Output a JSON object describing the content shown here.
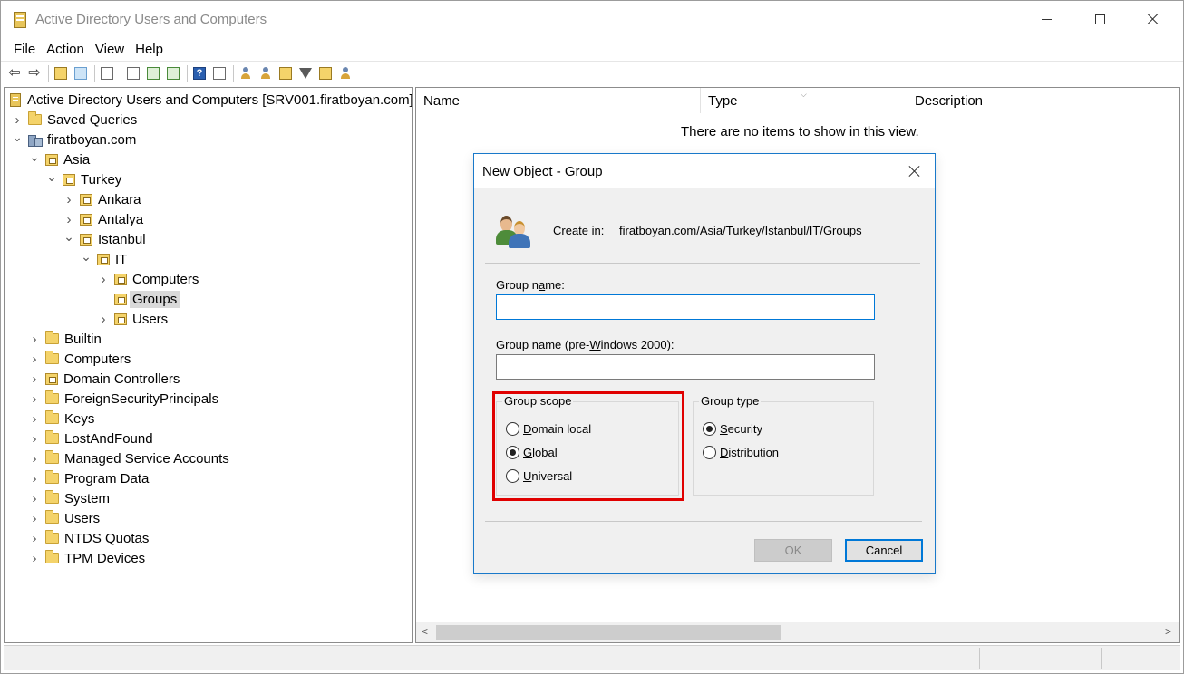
{
  "window": {
    "title": "Active Directory Users and Computers"
  },
  "menu": [
    "File",
    "Action",
    "View",
    "Help"
  ],
  "tree": {
    "root": "Active Directory Users and Computers [SRV001.firatboyan.com]",
    "items": [
      {
        "label": "Saved Queries",
        "level": 1,
        "chevron": "right",
        "icon": "folder-icon"
      },
      {
        "label": "firatboyan.com",
        "level": 1,
        "chevron": "down",
        "icon": "domain-icon"
      },
      {
        "label": "Asia",
        "level": 2,
        "chevron": "down",
        "icon": "ou-icon"
      },
      {
        "label": "Turkey",
        "level": 3,
        "chevron": "down",
        "icon": "ou-icon"
      },
      {
        "label": "Ankara",
        "level": 4,
        "chevron": "right",
        "icon": "ou-icon"
      },
      {
        "label": "Antalya",
        "level": 4,
        "chevron": "right",
        "icon": "ou-icon"
      },
      {
        "label": "Istanbul",
        "level": 4,
        "chevron": "down",
        "icon": "ou-icon"
      },
      {
        "label": "IT",
        "level": 5,
        "chevron": "down",
        "icon": "ou-icon"
      },
      {
        "label": "Computers",
        "level": 6,
        "chevron": "right",
        "icon": "ou-icon"
      },
      {
        "label": "Groups",
        "level": 6,
        "chevron": "none",
        "icon": "ou-icon",
        "selected": true
      },
      {
        "label": "Users",
        "level": 6,
        "chevron": "right",
        "icon": "ou-icon"
      },
      {
        "label": "Builtin",
        "level": 2,
        "chevron": "right",
        "icon": "folder-icon"
      },
      {
        "label": "Computers",
        "level": 2,
        "chevron": "right",
        "icon": "folder-icon"
      },
      {
        "label": "Domain Controllers",
        "level": 2,
        "chevron": "right",
        "icon": "ou-icon"
      },
      {
        "label": "ForeignSecurityPrincipals",
        "level": 2,
        "chevron": "right",
        "icon": "folder-icon"
      },
      {
        "label": "Keys",
        "level": 2,
        "chevron": "right",
        "icon": "folder-icon"
      },
      {
        "label": "LostAndFound",
        "level": 2,
        "chevron": "right",
        "icon": "folder-icon"
      },
      {
        "label": "Managed Service Accounts",
        "level": 2,
        "chevron": "right",
        "icon": "folder-icon"
      },
      {
        "label": "Program Data",
        "level": 2,
        "chevron": "right",
        "icon": "folder-icon"
      },
      {
        "label": "System",
        "level": 2,
        "chevron": "right",
        "icon": "folder-icon"
      },
      {
        "label": "Users",
        "level": 2,
        "chevron": "right",
        "icon": "folder-icon"
      },
      {
        "label": "NTDS Quotas",
        "level": 2,
        "chevron": "right",
        "icon": "folder-icon"
      },
      {
        "label": "TPM Devices",
        "level": 2,
        "chevron": "right",
        "icon": "folder-icon"
      }
    ]
  },
  "list": {
    "columns": [
      "Name",
      "Type",
      "Description"
    ],
    "empty_message": "There are no items to show in this view."
  },
  "dialog": {
    "title": "New Object - Group",
    "create_in_label": "Create in:",
    "create_in_path": "firatboyan.com/Asia/Turkey/Istanbul/IT/Groups",
    "group_name_label_pre": "Group n",
    "group_name_label_u": "a",
    "group_name_label_post": "me:",
    "group_name_value": "",
    "pre2000_label_pre": "Group name (pre-",
    "pre2000_label_u": "W",
    "pre2000_label_post": "indows 2000):",
    "pre2000_value": "",
    "group_scope": {
      "title": "Group scope",
      "options": [
        {
          "u": "D",
          "rest": "omain local",
          "checked": false
        },
        {
          "u": "G",
          "rest": "lobal",
          "checked": true
        },
        {
          "u": "U",
          "rest": "niversal",
          "checked": false
        }
      ]
    },
    "group_type": {
      "title": "Group type",
      "options": [
        {
          "u": "S",
          "rest": "ecurity",
          "checked": true
        },
        {
          "u": "D",
          "rest": "istribution",
          "checked": false
        }
      ]
    },
    "ok_label": "OK",
    "cancel_label": "Cancel"
  },
  "colors": {
    "accent": "#0078d7",
    "highlight": "#e00000",
    "folder": "#f4d36a"
  }
}
